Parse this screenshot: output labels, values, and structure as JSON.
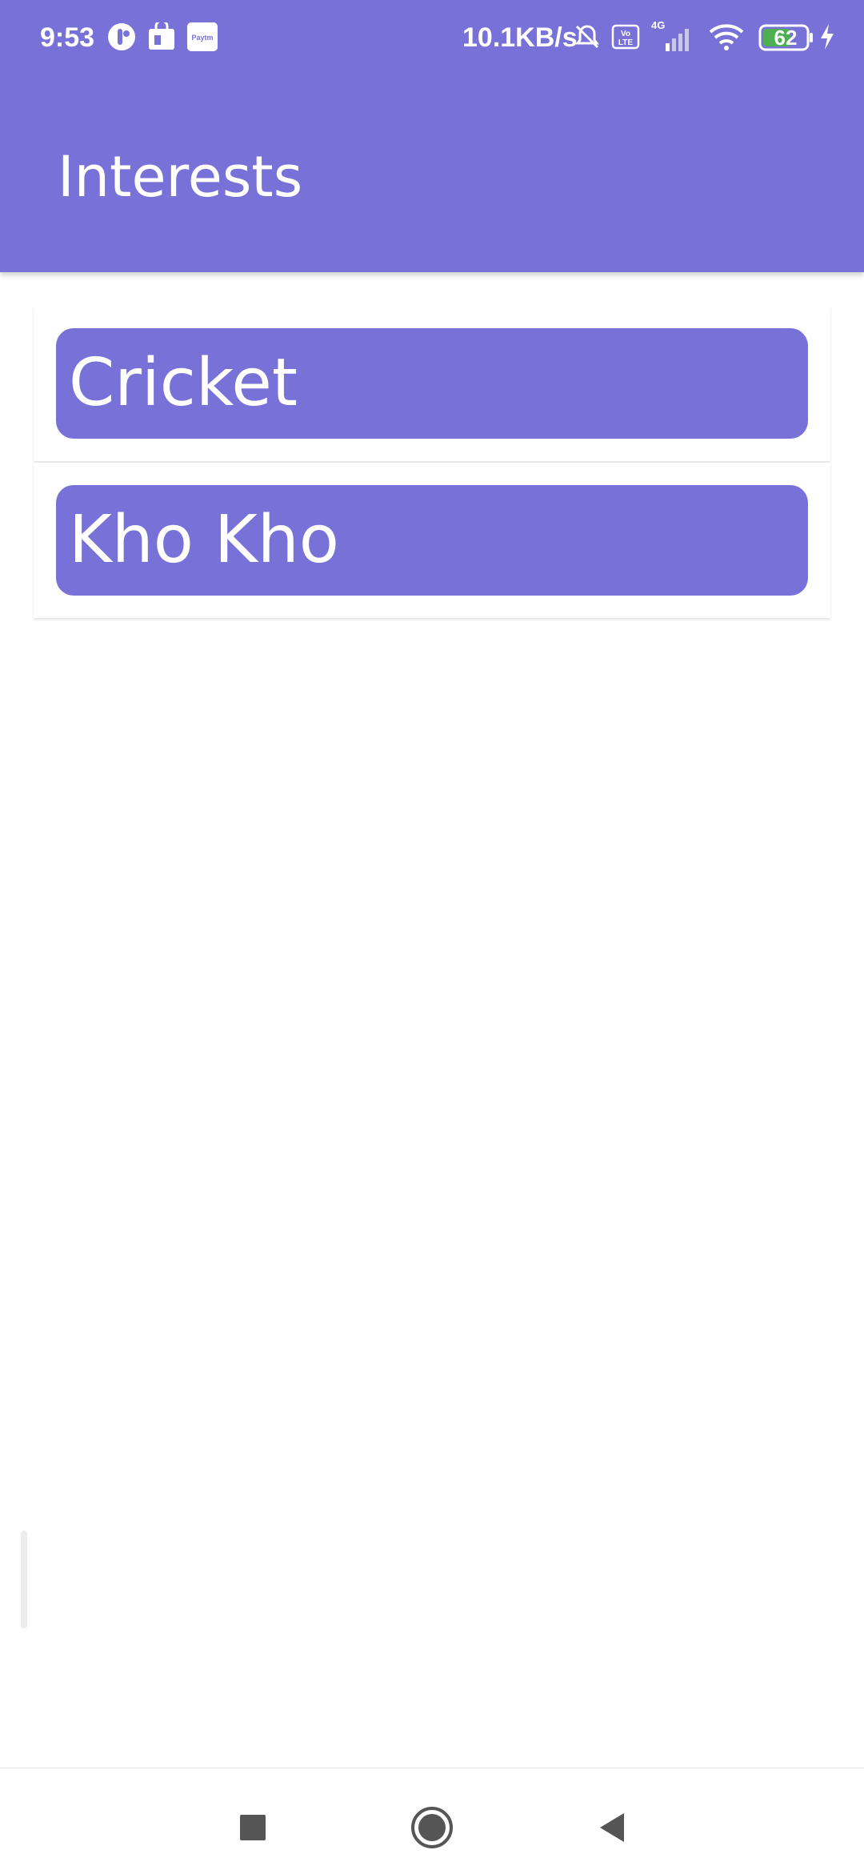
{
  "status_bar": {
    "time": "9:53",
    "network_speed": "10.1KB/s",
    "network_type": "4G",
    "volte": "Vo LTE",
    "battery_level": "62",
    "app_icons": [
      "app-circle-icon",
      "shopping-bag-icon",
      "paytm-icon"
    ],
    "paytm_label": "Paytm"
  },
  "app_bar": {
    "title": "Interests"
  },
  "interests": [
    {
      "label": "Cricket"
    },
    {
      "label": "Kho Kho"
    }
  ],
  "colors": {
    "primary": "#7872d8",
    "background": "#ffffff",
    "text_on_primary": "#ffffff"
  },
  "nav_bar": {
    "buttons": [
      "recents-square-icon",
      "home-circle-icon",
      "back-triangle-icon"
    ]
  }
}
